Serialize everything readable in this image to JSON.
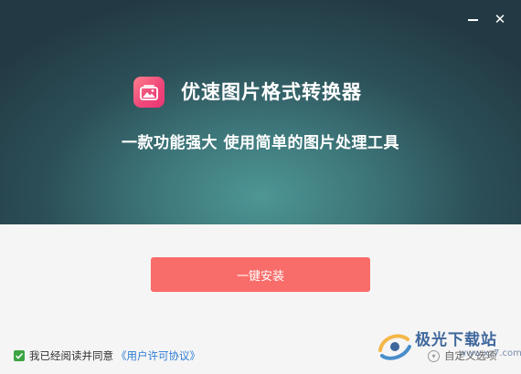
{
  "window": {
    "min_icon": "minimize-icon",
    "close_icon": "close-icon",
    "close_glyph": "✕"
  },
  "hero": {
    "app_icon": "image-icon",
    "app_title": "优速图片格式转换器",
    "subtitle": "一款功能强大 使用简单的图片处理工具",
    "colors": {
      "bg_dark": "#233a44",
      "bg_light": "#4e9695",
      "icon_pink": "#f0487a"
    }
  },
  "install": {
    "button_label": "一键安装",
    "color": "#f86c69"
  },
  "agreement": {
    "checked": true,
    "check_glyph": "✓",
    "text": "我已经阅读并同意",
    "link": "《用户许可协议》",
    "link_color": "#2a7bd4"
  },
  "options": {
    "custom_label": "自定义选项",
    "arrow_icon": "chevron-down-icon",
    "arrow_glyph": "▾"
  },
  "watermark": {
    "text": "极光下载站",
    "url": "www.xz7.com"
  }
}
